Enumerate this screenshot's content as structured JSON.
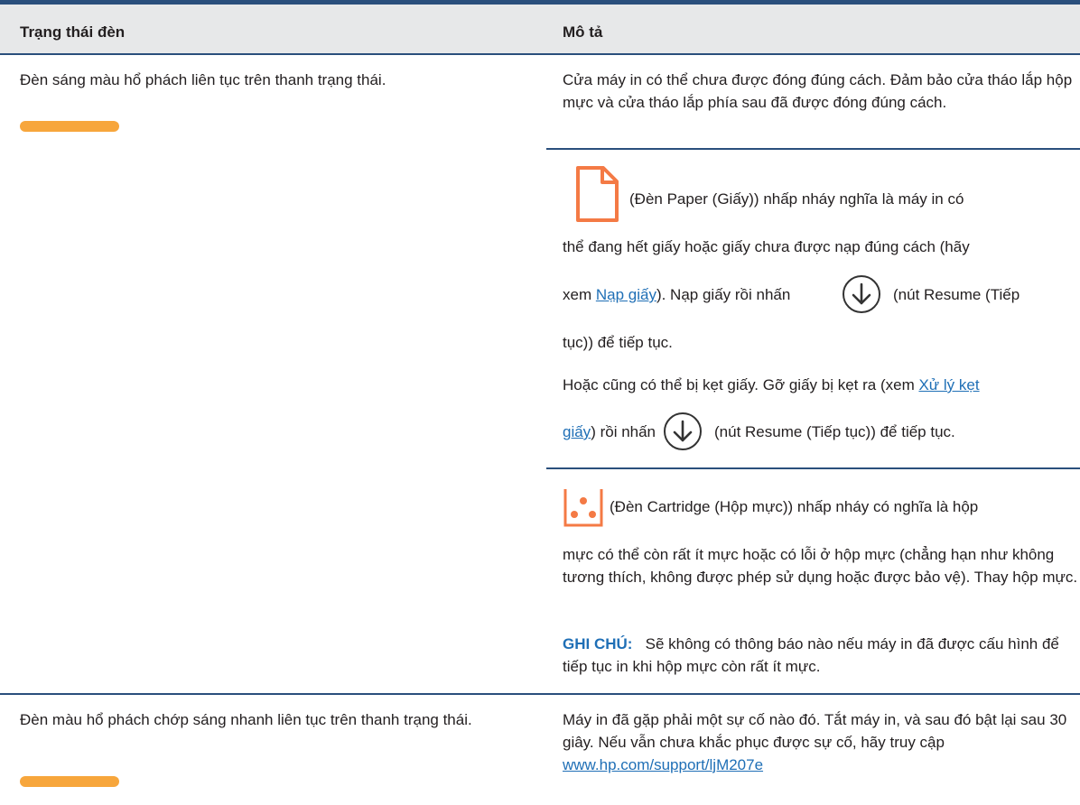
{
  "table": {
    "header": {
      "status": "Trạng thái đèn",
      "description": "Mô tả"
    },
    "row1": {
      "status": "Đèn sáng màu hổ phách liên tục trên thanh trạng thái.",
      "desc_door": "Cửa máy in có thể chưa được đóng đúng cách. Đảm bảo cửa tháo lắp hộp mực và cửa tháo lắp phía sau đã được đóng đúng cách.",
      "paper": {
        "line1": "(Đèn Paper (Giấy)) nhấp nháy nghĩa là máy in có",
        "line2": "thể đang hết giấy hoặc giấy chưa được nạp đúng cách (hãy",
        "line3_pre": "xem ",
        "link_load": "Nạp giấy",
        "line3_mid": "). Nạp giấy rồi nhấn",
        "line3_post": "(nút Resume (Tiếp",
        "line4": "tục)) để tiếp tục.",
        "jam_line1": "Hoặc cũng có thể bị kẹt giấy. Gỡ giấy bị kẹt ra (xem ",
        "link_jam_a": "Xử lý kẹt",
        "link_jam_b": "giấy",
        "jam_line2_mid": ") rồi nhấn",
        "jam_line2_post": "(nút Resume (Tiếp tục)) để tiếp tục."
      },
      "cartridge": {
        "line1": "(Đèn Cartridge (Hộp mực)) nhấp nháy có nghĩa là hộp",
        "line2": "mực có thể còn rất ít mực hoặc có lỗi ở hộp mực (chẳng hạn như không tương thích, không được phép sử dụng hoặc được bảo vệ). Thay hộp mực.",
        "note_label": "GHI CHÚ:",
        "note_text": "Sẽ không có thông báo nào nếu máy in đã được cấu hình để tiếp tục in khi hộp mực còn rất ít mực."
      }
    },
    "row2": {
      "status": "Đèn màu hổ phách chớp sáng nhanh liên tục trên thanh trạng thái.",
      "desc": "Máy in đã gặp phải một sự cố nào đó. Tắt máy in, và sau đó bật lại sau 30 giây. Nếu vẫn chưa khắc phục được sự cố, hãy truy cập ",
      "link_support": "www.hp.com/support/ljM207e"
    }
  },
  "colors": {
    "rule": "#2a4f7c",
    "header_bg": "#e7e8e9",
    "amber_bar": "#f7a63c",
    "paper_icon": "#f47a45",
    "link": "#1f6fb6"
  },
  "icons": [
    "status-bar-light-icon",
    "paper-light-icon",
    "resume-button-icon",
    "cartridge-light-icon"
  ]
}
